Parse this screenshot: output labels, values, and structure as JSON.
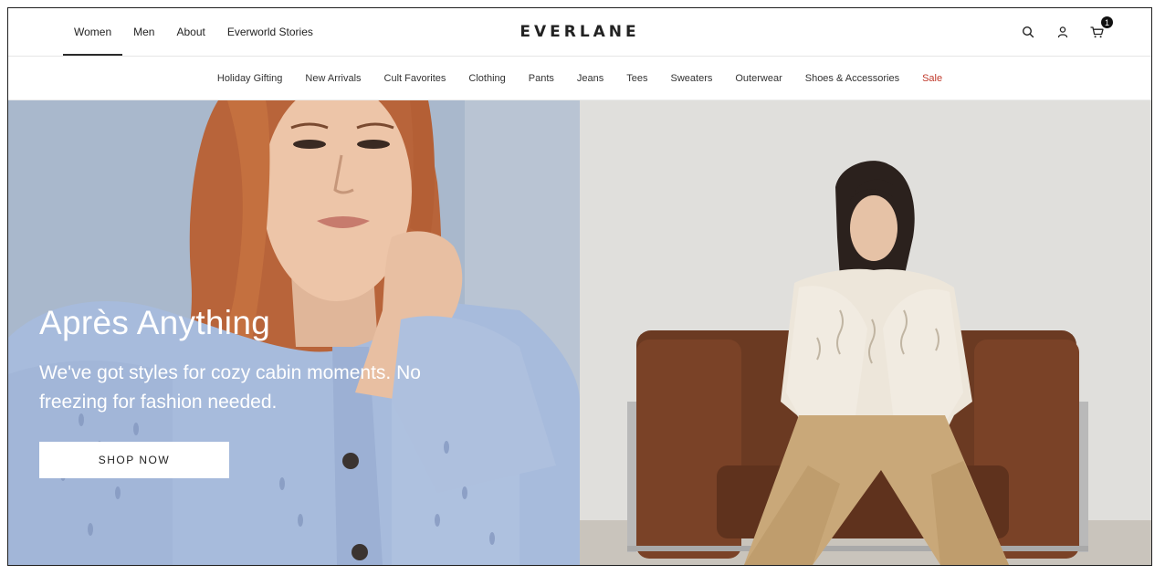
{
  "header": {
    "gender_nav": [
      {
        "label": "Women",
        "active": true
      },
      {
        "label": "Men",
        "active": false
      },
      {
        "label": "About",
        "active": false
      },
      {
        "label": "Everworld Stories",
        "active": false
      }
    ],
    "logo": "EVERLANE",
    "icons": [
      "search-icon",
      "account-icon",
      "cart-icon"
    ],
    "cart_count": "1"
  },
  "categories": [
    {
      "label": "Holiday Gifting"
    },
    {
      "label": "New Arrivals"
    },
    {
      "label": "Cult Favorites"
    },
    {
      "label": "Clothing"
    },
    {
      "label": "Pants"
    },
    {
      "label": "Jeans"
    },
    {
      "label": "Tees"
    },
    {
      "label": "Sweaters"
    },
    {
      "label": "Outerwear"
    },
    {
      "label": "Shoes & Accessories"
    },
    {
      "label": "Sale"
    }
  ],
  "hero": {
    "title": "Après Anything",
    "subtitle": "We've got styles for cozy cabin moments. No freezing for fashion needed.",
    "cta": "SHOP NOW"
  },
  "colors": {
    "sale": "#c0392b",
    "sweater_blue": "#a7bbdc",
    "couch_brown": "#6b3a22",
    "pants_tan": "#c9a879"
  }
}
